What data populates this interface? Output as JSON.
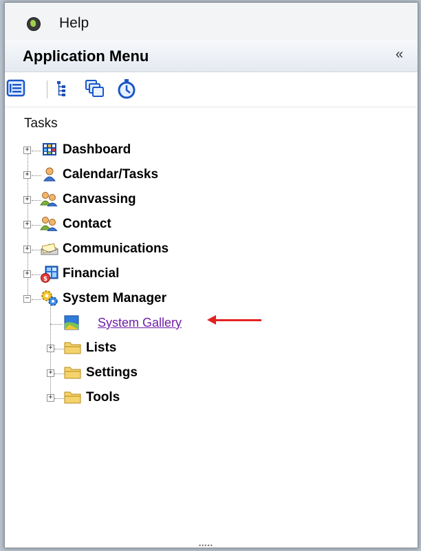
{
  "menubar": {
    "help_label": "Help"
  },
  "panel": {
    "title": "Application Menu",
    "collapse_glyph": "«"
  },
  "toolbar": {
    "icons": [
      "list-view-icon",
      "tree-view-icon",
      "windows-icon",
      "stopwatch-icon"
    ]
  },
  "tasks": {
    "heading": "Tasks",
    "items": [
      {
        "label": "Dashboard",
        "icon": "dashboard-icon"
      },
      {
        "label": "Calendar/Tasks",
        "icon": "person-icon"
      },
      {
        "label": "Canvassing",
        "icon": "people-icon"
      },
      {
        "label": "Contact",
        "icon": "people-icon"
      },
      {
        "label": "Communications",
        "icon": "envelopes-icon"
      },
      {
        "label": "Financial",
        "icon": "financial-icon"
      },
      {
        "label": "System Manager",
        "icon": "gears-icon"
      }
    ],
    "children": [
      {
        "label": "System Gallery",
        "icon": "gallery-icon"
      },
      {
        "label": "Lists",
        "icon": "folder-icon"
      },
      {
        "label": "Settings",
        "icon": "folder-icon"
      },
      {
        "label": "Tools",
        "icon": "folder-icon"
      }
    ]
  },
  "colors": {
    "link": "#6f1ea6",
    "arrow": "#e22222",
    "folder": "#f5d36b"
  }
}
